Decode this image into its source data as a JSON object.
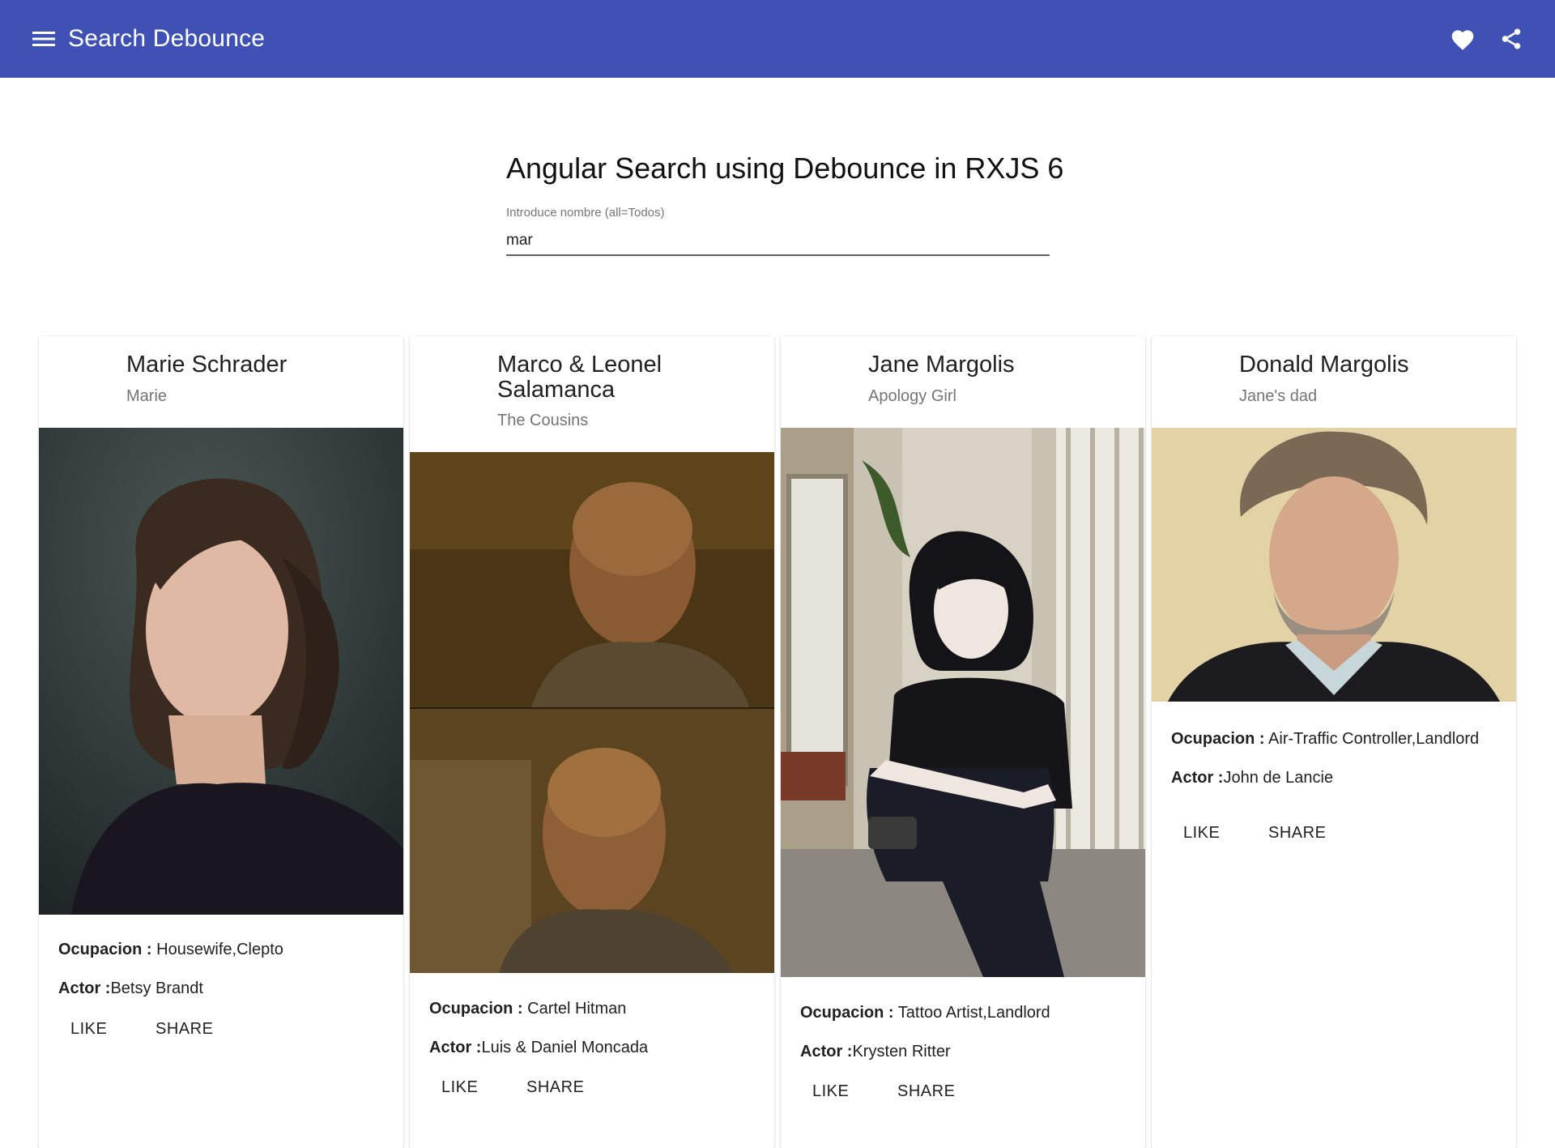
{
  "toolbar": {
    "title": "Search Debounce",
    "menu_icon": "menu-icon",
    "favorite_icon": "heart-icon",
    "share_icon": "share-icon",
    "color": "#3f51b5"
  },
  "main": {
    "heading": "Angular Search using Debounce in RXJS 6",
    "search": {
      "label": "Introduce nombre (all=Todos)",
      "value": "mar"
    }
  },
  "labels": {
    "occupation": "Ocupacion :",
    "actor": "Actor :",
    "like": "LIKE",
    "share": "SHARE"
  },
  "cards": [
    {
      "name": "Marie Schrader",
      "nickname": "Marie",
      "occupation": "Housewife,Clepto",
      "actor": "Betsy Brandt"
    },
    {
      "name": "Marco & Leonel Salamanca",
      "nickname": "The Cousins",
      "occupation": "Cartel Hitman",
      "actor": "Luis & Daniel Moncada"
    },
    {
      "name": "Jane Margolis",
      "nickname": "Apology Girl",
      "occupation": "Tattoo Artist,Landlord",
      "actor": "Krysten Ritter"
    },
    {
      "name": "Donald Margolis",
      "nickname": "Jane's dad",
      "occupation": "Air-Traffic Controller,Landlord",
      "actor": "John de Lancie"
    }
  ]
}
